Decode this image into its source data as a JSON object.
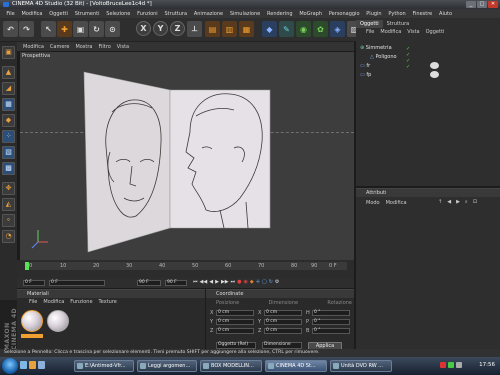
{
  "window": {
    "title": "CINEMA 4D Studio (32 Bit) - [VoltoBruceLee1c4d *]",
    "btn_min": "_",
    "btn_max": "□",
    "btn_close": "✕"
  },
  "menubar": [
    "File",
    "Modifica",
    "Oggetti",
    "Strumenti",
    "Selezione",
    "Funzioni",
    "Struttura",
    "Animazione",
    "Simulazione",
    "Rendering",
    "MoGraph",
    "Personaggio",
    "Plugin",
    "Python",
    "Finestre",
    "Aiuto"
  ],
  "toolbar": {
    "x": "X",
    "y": "Y",
    "z": "Z"
  },
  "viewport": {
    "menu": [
      "Modifica",
      "Camere",
      "Mostra",
      "Filtro",
      "Vista"
    ],
    "label": "Prospettiva"
  },
  "timeline": {
    "ticks": [
      "0",
      "10",
      "20",
      "30",
      "40",
      "50",
      "60",
      "70",
      "80",
      "90"
    ],
    "end_label": "0 F"
  },
  "playback": {
    "start": "0 F",
    "current": "0 F",
    "end": "90 F",
    "fps_field": "90 F"
  },
  "materials": {
    "title": "Materiali",
    "menu": [
      "File",
      "Modifica",
      "Funzione",
      "Texture"
    ]
  },
  "coordinates": {
    "title": "Coordinate",
    "sections": [
      "Posizione",
      "Dimensione",
      "Rotazione"
    ],
    "rows": [
      [
        "X",
        "0 cm",
        "X",
        "0 cm",
        "H",
        "0 °"
      ],
      [
        "Y",
        "0 cm",
        "Y",
        "0 cm",
        "P",
        "0 °"
      ],
      [
        "Z",
        "0 cm",
        "Z",
        "0 cm",
        "B",
        "0 °"
      ]
    ],
    "mode": "Oggetto (Rel)",
    "mode2": "Dimensione",
    "apply": "Applica"
  },
  "object_manager": {
    "tabs": [
      "Oggetti",
      "Struttura"
    ],
    "menu": [
      "File",
      "Modifica",
      "Vista",
      "Oggetti"
    ],
    "objects": [
      "Simmetria",
      "Poligono",
      "fr",
      "fp"
    ]
  },
  "attributes": {
    "title": "Attributi",
    "menu": [
      "Modo",
      "Modifica"
    ]
  },
  "side_label": "MAXON CINEMA 4D",
  "status": "Selezione a Pennello: Clicca e trascina per selezionare elementi. Tieni premuto SHIFT per aggiungere alla selezione, CTRL per rimuovere.",
  "taskbar": {
    "items": [
      "E:\\Antimed-Vfr...",
      "Leggi argomen...",
      "BOX MODELLIN...",
      "CINEMA 4D St...",
      "Unità DVD RW ..."
    ],
    "clock": "17:56"
  }
}
